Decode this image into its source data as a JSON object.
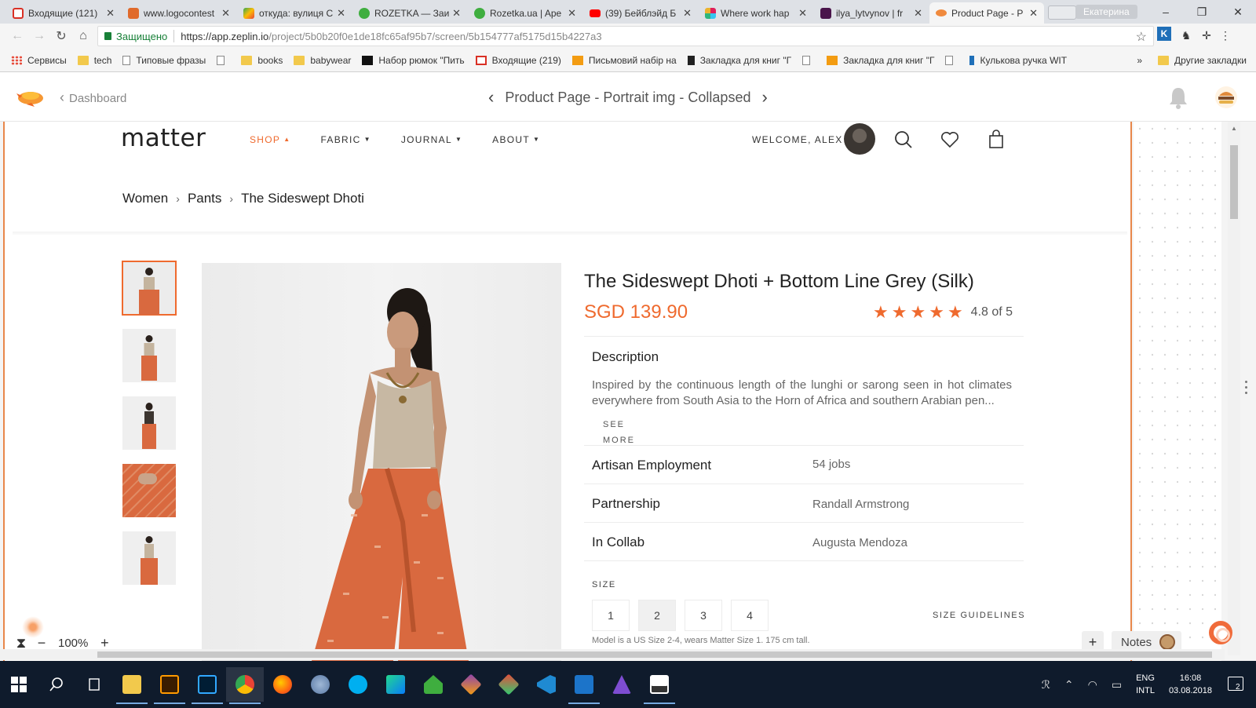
{
  "browser": {
    "tabs": [
      {
        "title": "Входящие (121)",
        "color": "#d93025"
      },
      {
        "title": "www.logocontest",
        "color": "#e06a2b"
      },
      {
        "title": "откуда: вулиця С",
        "color": "#34a853"
      },
      {
        "title": "ROZETKA — Заи",
        "color": "#3fae3f"
      },
      {
        "title": "Rozetka.ua | Ape",
        "color": "#3fae3f"
      },
      {
        "title": "(39) Бейблэйд Б",
        "color": "#ff0000"
      },
      {
        "title": "Where work hap",
        "color": "#e07b39"
      },
      {
        "title": "ilya_lytvynov | fr",
        "color": "#4a154b"
      },
      {
        "title": "Product Page - P",
        "color": "#f08a3e"
      }
    ],
    "profile_name": "Екатерина",
    "window_controls": [
      "–",
      "❐",
      "✕"
    ],
    "secure_label": "Защищено",
    "url_host": "https://app.zeplin.io",
    "url_path": "/project/5b0b20f0e1de18fc65af95b7/screen/5b154777af5175d15b4227a3",
    "bookmarks": [
      {
        "label": "Сервисы",
        "kind": "apps"
      },
      {
        "label": "tech",
        "kind": "folder"
      },
      {
        "label": "Типовые фразы",
        "kind": "page"
      },
      {
        "label": "",
        "kind": "page"
      },
      {
        "label": "books",
        "kind": "folder"
      },
      {
        "label": "babywear",
        "kind": "folder"
      },
      {
        "label": "Набор рюмок \"Пить",
        "kind": "site"
      },
      {
        "label": "Входящие (219)",
        "kind": "gmail"
      },
      {
        "label": "Письмовий набір на",
        "kind": "b"
      },
      {
        "label": "Закладка для книг \"Г",
        "kind": "site"
      },
      {
        "label": "",
        "kind": "page"
      },
      {
        "label": "Закладка для книг \"Г",
        "kind": "b"
      },
      {
        "label": "",
        "kind": "page"
      },
      {
        "label": "Кулькова ручка WIT",
        "kind": "site"
      }
    ],
    "bookmarks_more": "»",
    "other_bookmarks": "Другие закладки"
  },
  "zeplin": {
    "back_label": "Dashboard",
    "screen_title": "Product Page - Portrait img - Collapsed",
    "zoom": "100%",
    "notes_label": "Notes"
  },
  "site": {
    "logo": "matter",
    "nav": [
      {
        "label": "SHOP",
        "active": true
      },
      {
        "label": "FABRIC",
        "active": false
      },
      {
        "label": "JOURNAL",
        "active": false
      },
      {
        "label": "ABOUT",
        "active": false
      }
    ],
    "welcome": "WELCOME, ALEX",
    "breadcrumb": [
      "Women",
      "Pants",
      "The Sideswept Dhoti"
    ],
    "product": {
      "title": "The Sideswept Dhoti + Bottom Line Grey (Silk)",
      "price": "SGD 139.90",
      "rating_stars": 5,
      "rating_text": "4.8 of 5",
      "description_heading": "Description",
      "description": "Inspired by the continuous length of the lunghi or sarong seen in hot climates everywhere from South Asia to the Horn of Africa and southern Arabian pen...",
      "see_more": "SEE MORE",
      "details": [
        {
          "label": "Artisan Employment",
          "value": "54 jobs"
        },
        {
          "label": "Partnership",
          "value": "Randall Armstrong"
        },
        {
          "label": "In Collab",
          "value": "Augusta Mendoza"
        }
      ],
      "size_heading": "SIZE",
      "sizes": [
        "1",
        "2",
        "3",
        "4"
      ],
      "selected_size": "2",
      "size_guidelines": "SIZE GUIDELINES",
      "model_note": "Model is a US Size 2-4, wears Matter Size 1. 175 cm tall."
    }
  },
  "taskbar": {
    "language": [
      "ENG",
      "INTL"
    ],
    "time": "16:08",
    "date": "03.08.2018",
    "notifications": "2"
  },
  "colors": {
    "accent": "#ef6a2e",
    "zeplin_border": "#e8874a",
    "taskbar": "#0f1b2c"
  }
}
